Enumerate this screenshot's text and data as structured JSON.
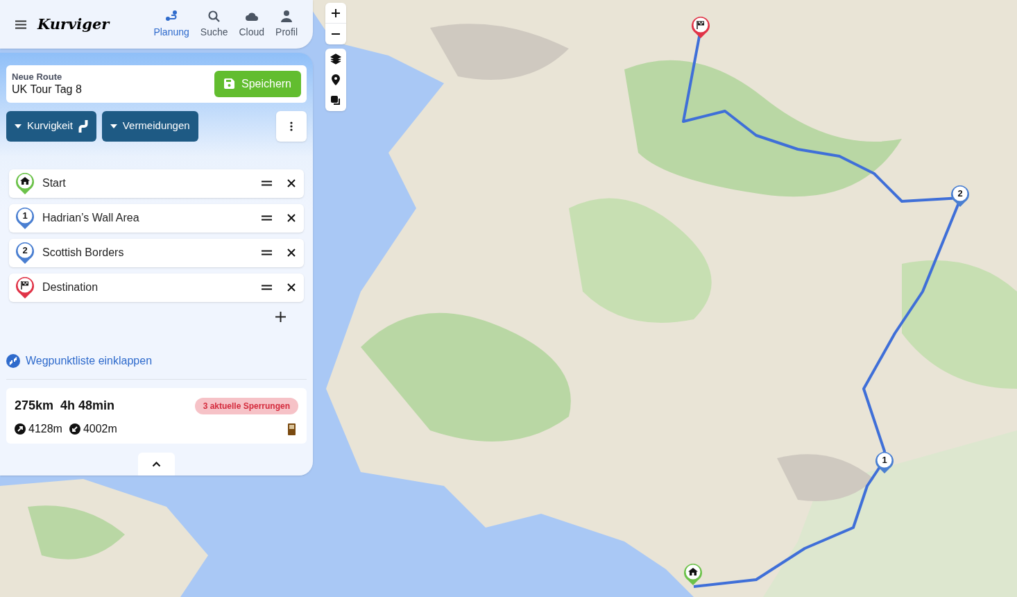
{
  "header": {
    "logo": "Kurviger",
    "nav": [
      {
        "label": "Planung",
        "selected": true
      },
      {
        "label": "Suche",
        "selected": false
      },
      {
        "label": "Cloud",
        "selected": false
      },
      {
        "label": "Profil",
        "selected": false
      }
    ]
  },
  "route": {
    "caption": "Neue Route",
    "name": "UK Tour Tag 8",
    "save": "Speichern"
  },
  "options": [
    {
      "label": "Kurvigkeit"
    },
    {
      "label": "Vermeidungen"
    }
  ],
  "waypoints": [
    {
      "kind": "start",
      "name": "Start"
    },
    {
      "kind": "via",
      "number": "1",
      "name": "Hadrian’s Wall Area"
    },
    {
      "kind": "via",
      "number": "2",
      "name": "Scottish Borders"
    },
    {
      "kind": "destination",
      "name": "Destination"
    }
  ],
  "collapse_link": "Wegpunktliste einklappen",
  "summary": {
    "distance": "275km",
    "duration": "4h 48min",
    "ascent": "4128m",
    "descent": "4002m",
    "closures": "3 aktuelle Sperrungen"
  },
  "map": {
    "kind": "picture",
    "markers": [
      {
        "kind": "destination"
      },
      {
        "kind": "via",
        "number": "2"
      },
      {
        "kind": "via",
        "number": "1"
      },
      {
        "kind": "start"
      }
    ]
  }
}
